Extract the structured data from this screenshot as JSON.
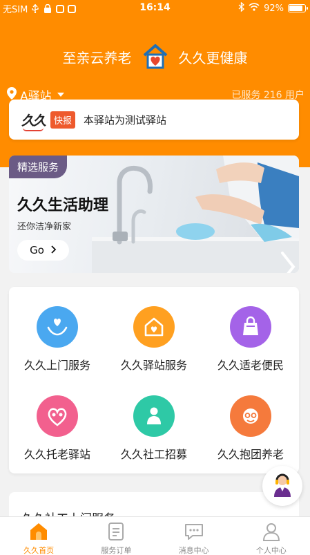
{
  "status_bar": {
    "carrier": "无SIM",
    "time": "16:14",
    "battery": "92%",
    "battery_level": 0.92
  },
  "header": {
    "slogan_left": "至亲云养老",
    "slogan_right": "久久更健康",
    "station": "A驿站",
    "served_text": "已服务 216 用户"
  },
  "news": {
    "logo_text": "久久",
    "tag": "快报",
    "text": "本驿站为测试驿站"
  },
  "banner": {
    "tag": "精选服务",
    "title": "久久生活助理",
    "subtitle": "还你洁净新家",
    "button": "Go"
  },
  "services": [
    {
      "label": "久久上门服务",
      "icon": "hand-heart-icon",
      "color": "#4aa8f0"
    },
    {
      "label": "久久驿站服务",
      "icon": "house-heart-icon",
      "color": "#ffa020"
    },
    {
      "label": "久久适老便民",
      "icon": "shopping-bag-icon",
      "color": "#a463e8"
    },
    {
      "label": "久久托老驿站",
      "icon": "heart-people-icon",
      "color": "#f2608e"
    },
    {
      "label": "久久社工招募",
      "icon": "social-worker-icon",
      "color": "#2ec9a6"
    },
    {
      "label": "久久抱团养老",
      "icon": "elder-face-icon",
      "color": "#f57a3c"
    }
  ],
  "next_section": {
    "title": "久久社工上门服务"
  },
  "tabs": [
    {
      "label": "久久首页",
      "icon": "home-icon",
      "active": true
    },
    {
      "label": "服务订单",
      "icon": "order-icon",
      "active": false
    },
    {
      "label": "消息中心",
      "icon": "message-icon",
      "active": false
    },
    {
      "label": "个人中心",
      "icon": "user-icon",
      "active": false
    }
  ],
  "colors": {
    "brand": "#ff8c00",
    "news_tag": "#ee5a2d",
    "banner_tag": "#6b5b85"
  }
}
